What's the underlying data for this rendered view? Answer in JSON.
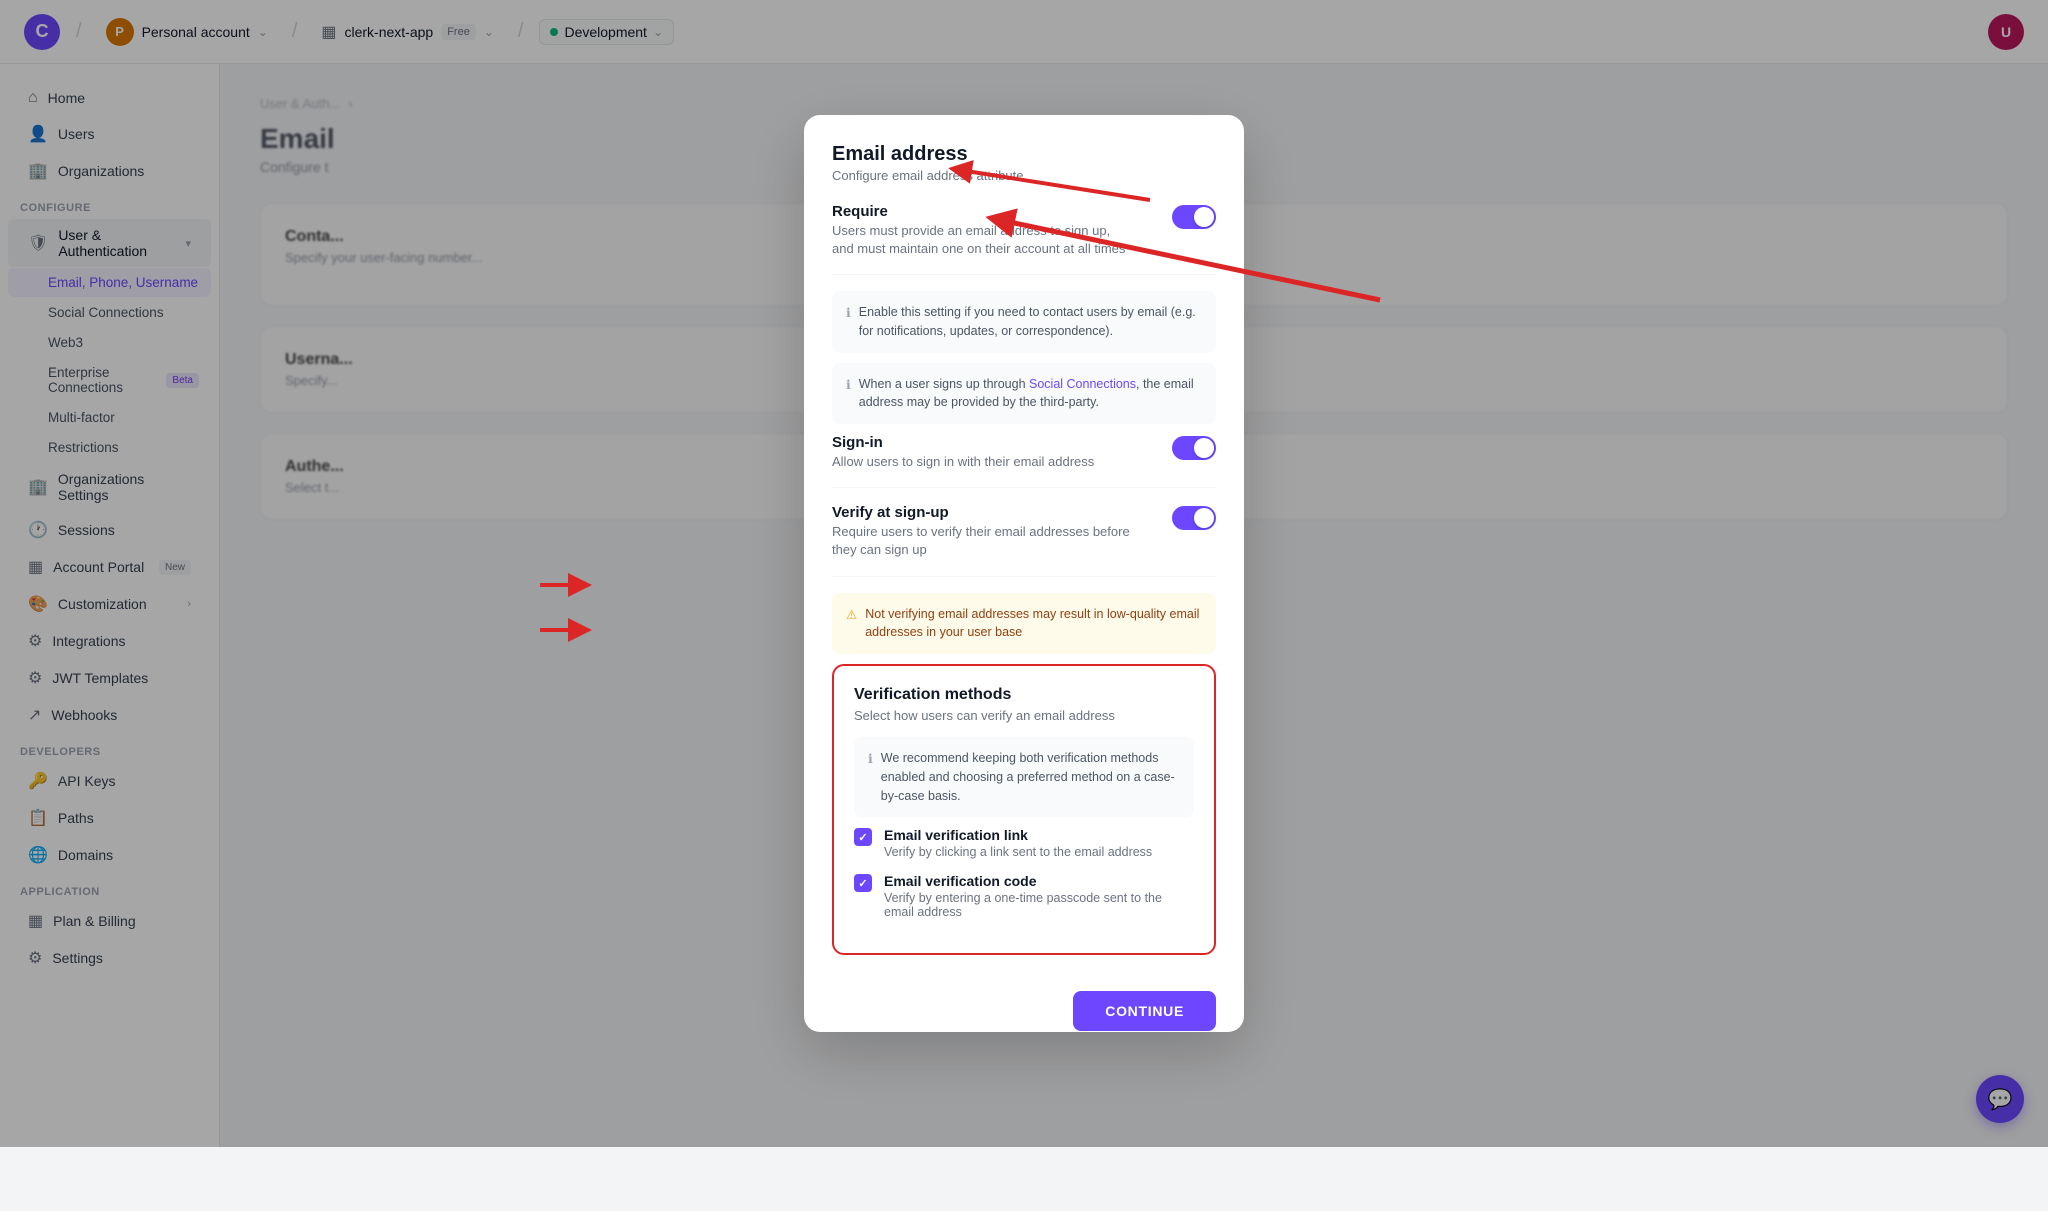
{
  "topnav": {
    "logo_letter": "C",
    "account_name": "Personal account",
    "sep": "/",
    "app_icon": "▦",
    "app_name": "clerk-next-app",
    "app_badge": "Free",
    "env_dot_color": "#10b981",
    "env_name": "Development",
    "user_initials": "U"
  },
  "sidebar": {
    "main_items": [
      {
        "id": "home",
        "icon": "⌂",
        "label": "Home"
      },
      {
        "id": "users",
        "icon": "👤",
        "label": "Users"
      },
      {
        "id": "organizations",
        "icon": "🏢",
        "label": "Organizations"
      }
    ],
    "configure_section": "CONFIGURE",
    "configure_items": [
      {
        "id": "user-auth",
        "icon": "🛡",
        "label": "User & Authentication",
        "expand": "▾",
        "active": true
      },
      {
        "id": "email-phone",
        "label": "Email, Phone, Username",
        "sub": true,
        "active": true
      },
      {
        "id": "social",
        "label": "Social Connections",
        "sub": true
      },
      {
        "id": "web3",
        "label": "Web3",
        "sub": true
      },
      {
        "id": "enterprise",
        "label": "Enterprise Connections",
        "sub": true,
        "beta": true
      },
      {
        "id": "multifactor",
        "label": "Multi-factor",
        "sub": true
      },
      {
        "id": "restrictions",
        "label": "Restrictions",
        "sub": true
      },
      {
        "id": "org-settings",
        "icon": "🏢",
        "label": "Organizations Settings"
      },
      {
        "id": "sessions",
        "icon": "🕐",
        "label": "Sessions"
      },
      {
        "id": "account-portal",
        "icon": "▦",
        "label": "Account Portal",
        "badge_new": true
      },
      {
        "id": "customization",
        "icon": "🎨",
        "label": "Customization",
        "expand": "›"
      },
      {
        "id": "integrations",
        "icon": "⚙",
        "label": "Integrations"
      },
      {
        "id": "jwt",
        "icon": "⚙",
        "label": "JWT Templates"
      },
      {
        "id": "webhooks",
        "icon": "↗",
        "label": "Webhooks"
      }
    ],
    "developers_section": "DEVELOPERS",
    "developers_items": [
      {
        "id": "api-keys",
        "icon": "🔑",
        "label": "API Keys"
      },
      {
        "id": "paths",
        "icon": "📋",
        "label": "Paths"
      },
      {
        "id": "domains",
        "icon": "🌐",
        "label": "Domains"
      }
    ],
    "application_section": "APPLICATION",
    "application_items": [
      {
        "id": "plan-billing",
        "icon": "▦",
        "label": "Plan & Billing"
      },
      {
        "id": "settings",
        "icon": "⚙",
        "label": "Settings"
      }
    ]
  },
  "main": {
    "breadcrumb_parent": "User & Auth...",
    "page_title": "Email",
    "page_subtitle": "Configure t"
  },
  "modal": {
    "title": "Email address",
    "subtitle": "Configure email address attribute",
    "require": {
      "label": "Require",
      "desc": "Users must provide an email address to sign up, and must maintain one on their account at all times",
      "toggle": "on"
    },
    "info1": "Enable this setting if you need to contact users by email (e.g. for notifications, updates, or correspondence).",
    "info2_prefix": "When a user signs up through ",
    "info2_link": "Social Connections",
    "info2_suffix": ", the email address may be provided by the third-party.",
    "sign_in": {
      "label": "Sign-in",
      "desc": "Allow users to sign in with their email address",
      "toggle": "on"
    },
    "verify": {
      "label": "Verify at sign-up",
      "desc": "Require users to verify their email addresses before they can sign up",
      "toggle": "on"
    },
    "warn_verify": "Not verifying email addresses may result in low-quality email addresses in your user base",
    "verification": {
      "title": "Verification methods",
      "desc": "Select how users can verify an email address",
      "info": "We recommend keeping both verification methods enabled and choosing a preferred method on a case-by-case basis.",
      "method1_label": "Email verification link",
      "method1_desc": "Verify by clicking a link sent to the email address",
      "method1_checked": true,
      "method2_label": "Email verification code",
      "method2_desc": "Verify by entering a one-time passcode sent to the email address",
      "method2_checked": true
    },
    "continue_btn": "CONTINUE"
  }
}
